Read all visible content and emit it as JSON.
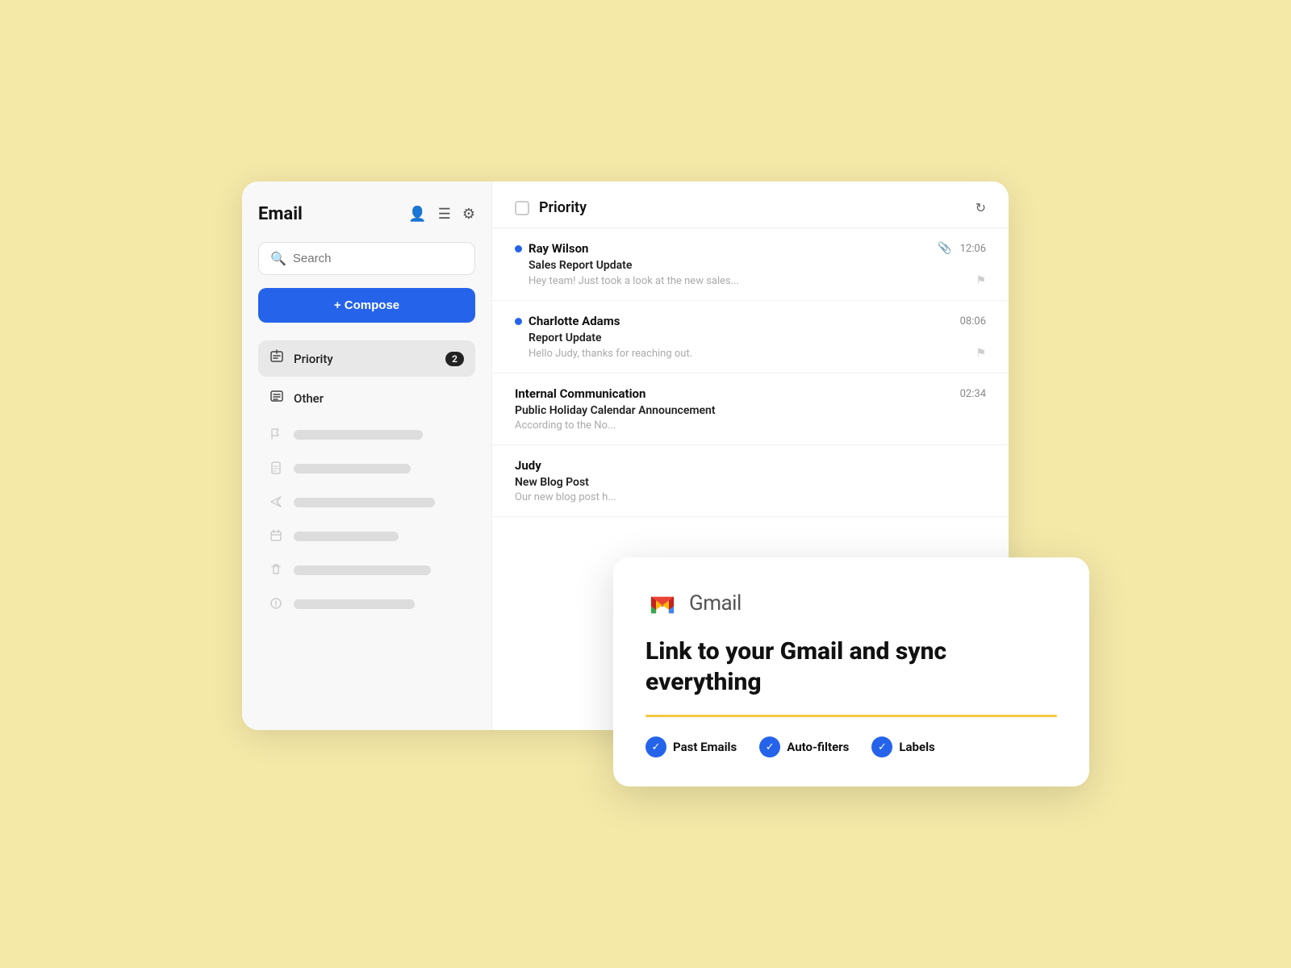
{
  "sidebar": {
    "title": "Email",
    "search_placeholder": "Search",
    "compose_label": "+ Compose",
    "nav_items": [
      {
        "id": "priority",
        "label": "Priority",
        "badge": "2",
        "active": true
      },
      {
        "id": "other",
        "label": "Other",
        "badge": "",
        "active": false
      }
    ],
    "skeleton_items": 5
  },
  "main": {
    "header_title": "Priority",
    "emails": [
      {
        "id": 1,
        "sender": "Ray Wilson",
        "subject": "Sales Report Update",
        "preview": "Hey team! Just took a look at the new sales...",
        "time": "12:06",
        "unread": true,
        "has_attachment": true
      },
      {
        "id": 2,
        "sender": "Charlotte Adams",
        "subject": "Report Update",
        "preview": "Hello Judy, thanks for reaching out.",
        "time": "08:06",
        "unread": true,
        "has_attachment": false
      },
      {
        "id": 3,
        "sender": "Internal Communication",
        "subject": "Public Holiday Calendar Announcement",
        "preview": "According to the No...",
        "time": "02:34",
        "unread": false,
        "has_attachment": false
      },
      {
        "id": 4,
        "sender": "Judy",
        "subject": "New Blog Post",
        "preview": "Our new blog post h...",
        "time": "",
        "unread": false,
        "has_attachment": false
      }
    ]
  },
  "gmail_card": {
    "wordmark": "Gmail",
    "headline": "Link to your Gmail and sync everything",
    "features": [
      {
        "id": "past-emails",
        "label": "Past Emails"
      },
      {
        "id": "auto-filters",
        "label": "Auto-filters"
      },
      {
        "id": "labels",
        "label": "Labels"
      }
    ]
  },
  "icons": {
    "search": "🔍",
    "compose_plus": "+",
    "person": "👤",
    "list": "☰",
    "gear": "⚙",
    "priority_inbox": "⬆",
    "other_inbox": "📋",
    "flag": "⚑",
    "document": "📄",
    "send": "➤",
    "calendar": "📅",
    "trash": "🗑",
    "alert": "⚠",
    "attachment": "📎",
    "check": "✓",
    "refresh": "↻"
  }
}
